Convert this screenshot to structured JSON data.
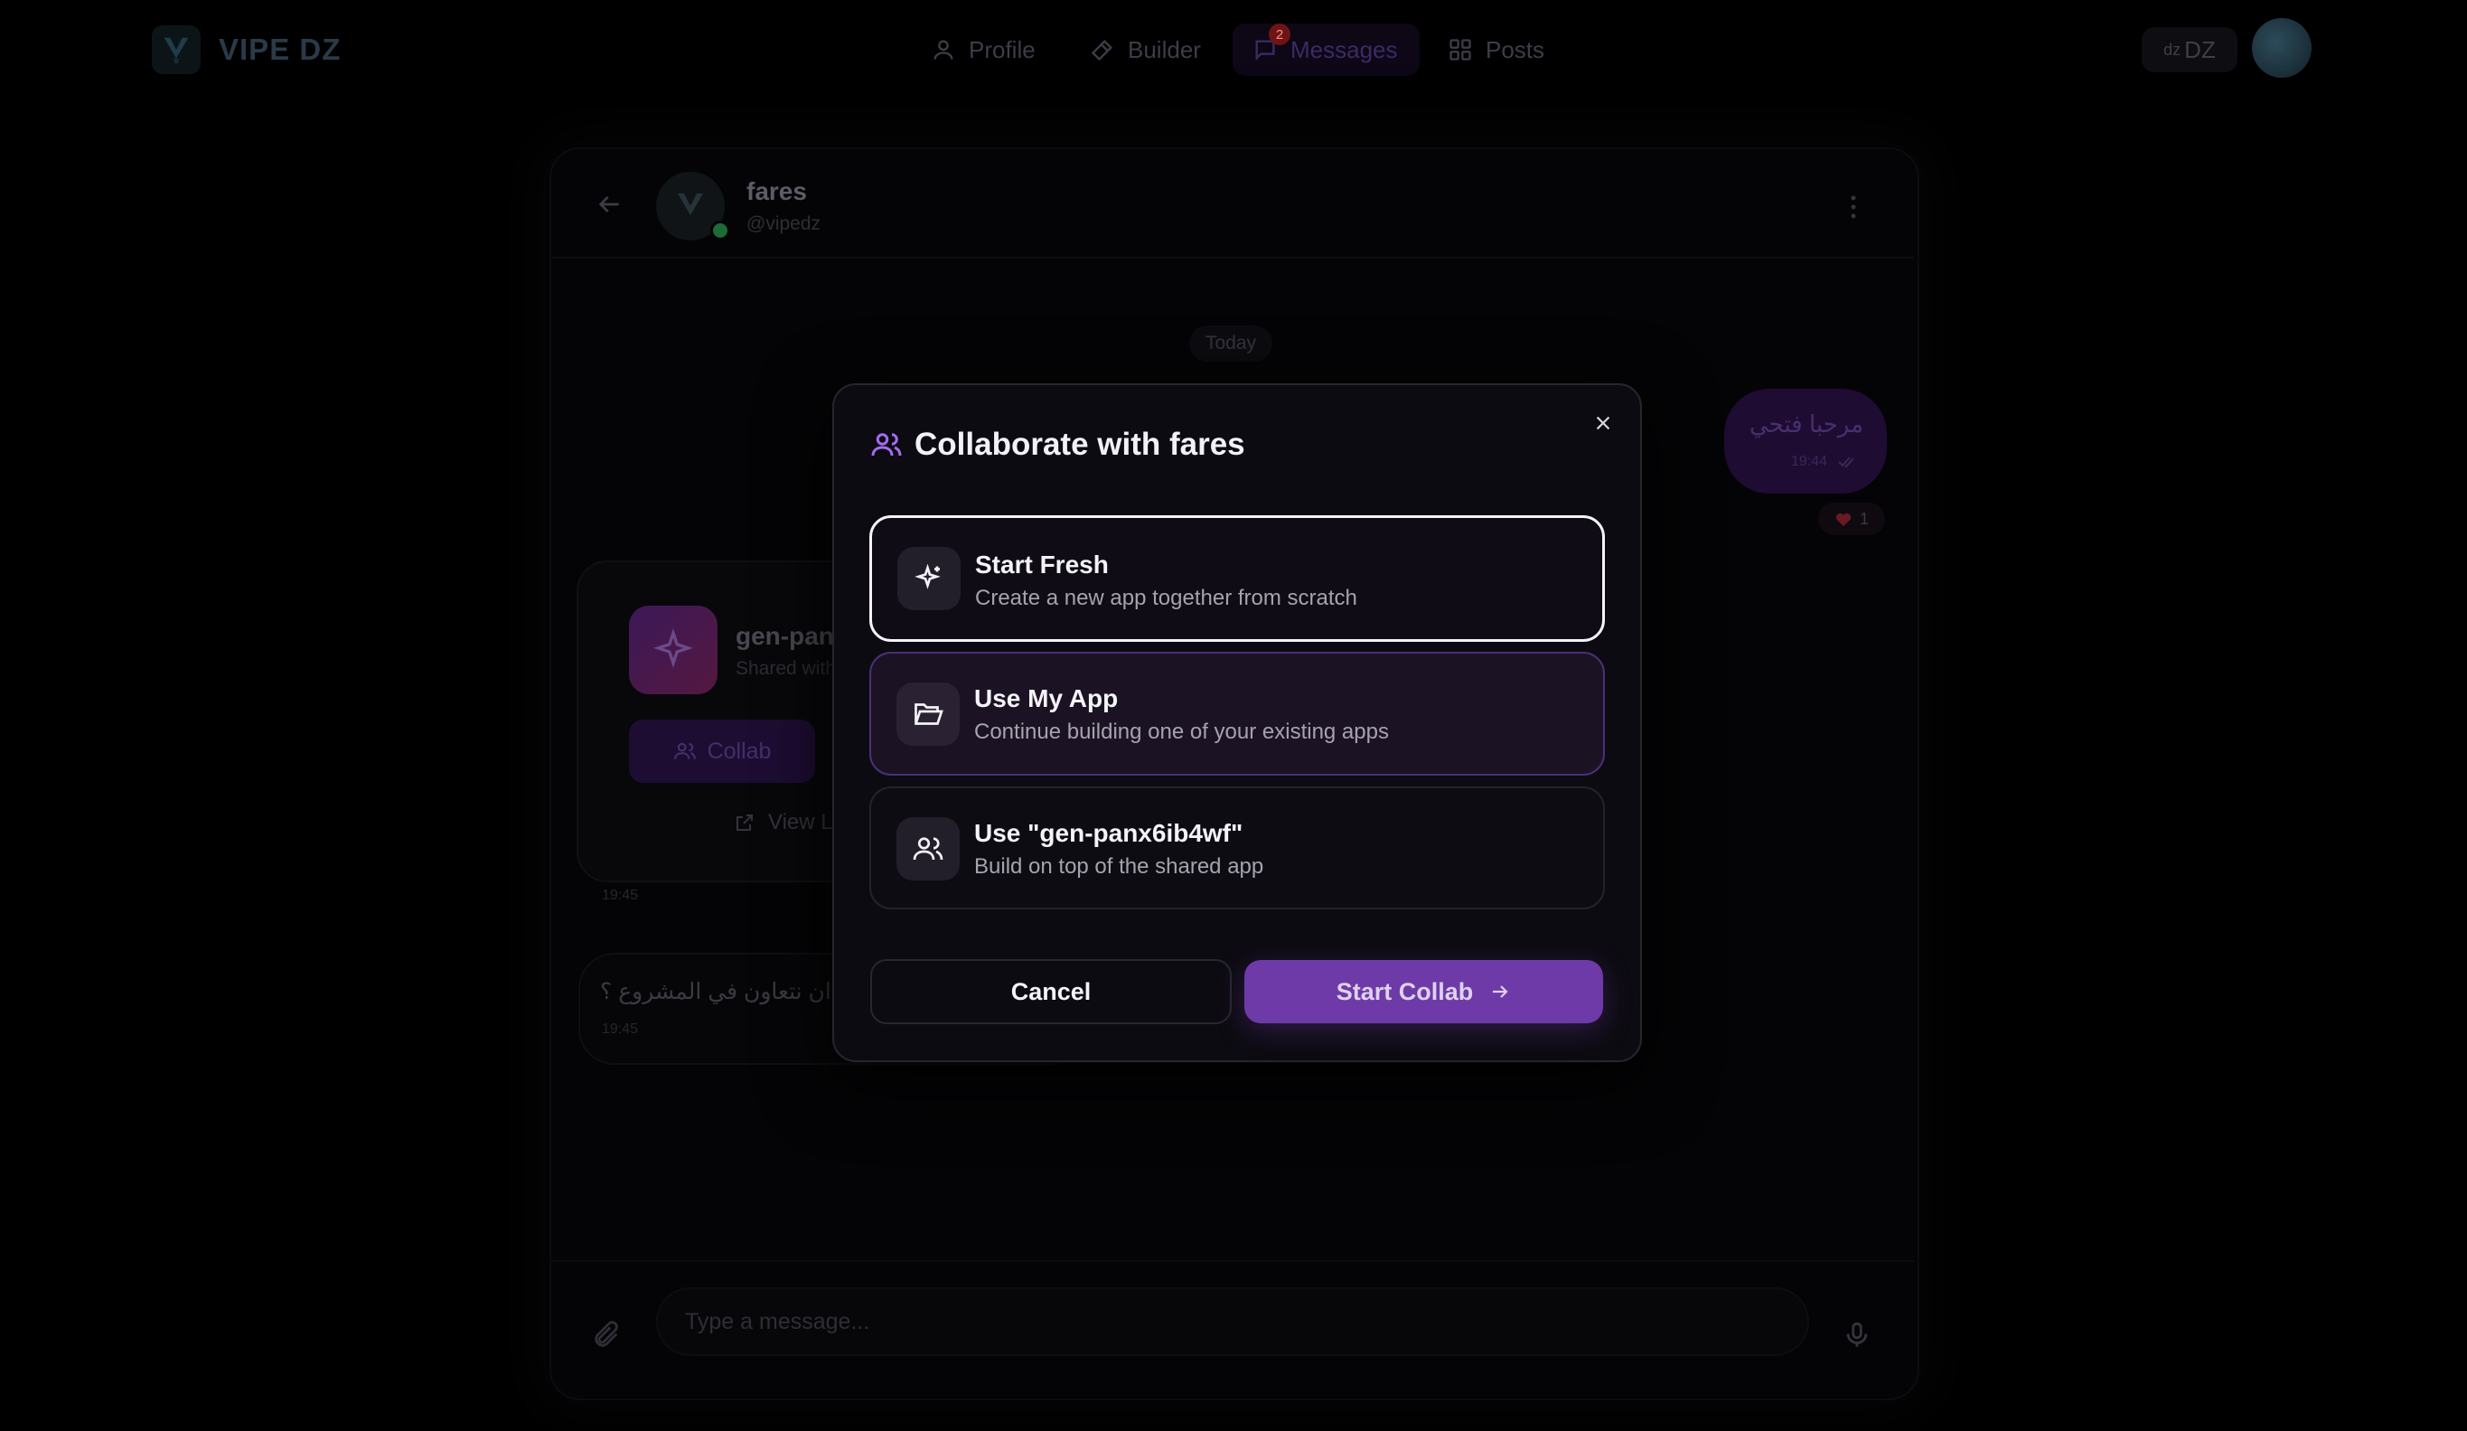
{
  "nav": {
    "brand": "VIPE DZ",
    "items": [
      {
        "label": "Profile",
        "icon": "user-icon"
      },
      {
        "label": "Builder",
        "icon": "hammer-icon"
      },
      {
        "label": "Messages",
        "icon": "message-icon",
        "badge": "2",
        "active": true
      },
      {
        "label": "Posts",
        "icon": "grid-icon"
      }
    ],
    "language": {
      "flag": "dz",
      "code": "DZ"
    }
  },
  "chat": {
    "name": "fares",
    "handle": "@vipedz",
    "date_divider": "Today",
    "outgoing": {
      "text": "مرحبا فتحي",
      "time": "19:44",
      "reaction_count": "1"
    },
    "shared_app": {
      "title": "gen-pan",
      "subtitle": "Shared with",
      "collab_label": "Collab",
      "view_label": "View L",
      "time": "19:45"
    },
    "incoming": {
      "text": "ان نتعاون في المشروع ؟",
      "time": "19:45"
    },
    "input_placeholder": "Type a message..."
  },
  "modal": {
    "title": "Collaborate with fares",
    "options": [
      {
        "title": "Start Fresh",
        "description": "Create a new app together from scratch",
        "icon": "sparkles-icon",
        "selected": true
      },
      {
        "title": "Use My App",
        "description": "Continue building one of your existing apps",
        "icon": "folder-open-icon"
      },
      {
        "title": "Use \"gen-panx6ib4wf\"",
        "description": "Build on top of the shared app",
        "icon": "users-icon"
      }
    ],
    "cancel_label": "Cancel",
    "confirm_label": "Start Collab"
  },
  "colors": {
    "accent": "#6e3aa7",
    "modal_bg": "#0d0b12",
    "selected_border": "#f4f4f8",
    "hover_border": "#4a2f78"
  }
}
